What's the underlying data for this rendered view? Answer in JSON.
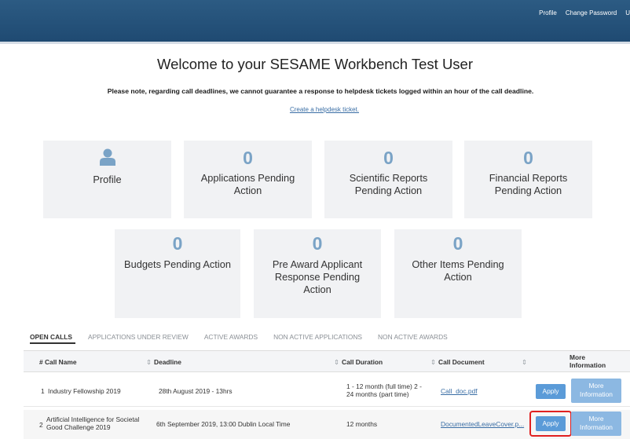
{
  "header": {
    "links": [
      "Profile",
      "Change Password",
      "U"
    ]
  },
  "welcome_title": "Welcome to your SESAME Workbench Test User",
  "notice": "Please note, regarding call deadlines, we cannot guarantee a response to helpdesk tickets logged within an hour of the call deadline.",
  "helpdesk_link": "Create a helpdesk ticket.",
  "tiles": {
    "profile": {
      "label": "Profile",
      "icon": "user-icon"
    },
    "applications_pending": {
      "count": "0",
      "label_lines": [
        "Applications Pending",
        "Action"
      ]
    },
    "scientific_reports": {
      "count": "0",
      "label_lines": [
        "Scientific Reports",
        "Pending Action"
      ]
    },
    "financial_reports": {
      "count": "0",
      "label_lines": [
        "Financial Reports",
        "Pending Action"
      ]
    },
    "budgets_pending": {
      "count": "0",
      "label_lines": [
        "Budgets Pending Action"
      ]
    },
    "pre_award": {
      "count": "0",
      "label_lines": [
        "Pre Award Applicant",
        "Response Pending",
        "Action"
      ]
    },
    "other_items": {
      "count": "0",
      "label_lines": [
        "Other Items Pending",
        "Action"
      ]
    }
  },
  "tabs": [
    "OPEN CALLS",
    "APPLICATIONS UNDER REVIEW",
    "ACTIVE AWARDS",
    "NON ACTIVE APPLICATIONS",
    "NON ACTIVE AWARDS"
  ],
  "table": {
    "headers": {
      "num_name": "# Call Name",
      "deadline": "Deadline",
      "duration": "Call Duration",
      "document": "Call Document",
      "more_info_lines": [
        "More",
        "Information"
      ]
    },
    "rows": [
      {
        "num": "1",
        "name_lines": [
          "Industry Fellowship 2019"
        ],
        "deadline": "28th August 2019 - 13hrs",
        "duration_lines": [
          "1 - 12 month (full time) 2 -",
          "24 months (part time)"
        ],
        "document": "Call_doc.pdf",
        "apply": "Apply",
        "more_lines": [
          "More",
          "Information"
        ]
      },
      {
        "num": "2",
        "name_lines": [
          "Artificial Intelligence for Societal",
          "Good Challenge 2019"
        ],
        "deadline": "6th September 2019, 13:00 Dublin Local Time",
        "duration_lines": [
          "12 months"
        ],
        "document": "DocumentedLeaveCover.p...",
        "apply": "Apply",
        "more_lines": [
          "More",
          "Information"
        ]
      }
    ]
  },
  "colors": {
    "header_bg": "#2c5b83",
    "tile_bg": "#f1f2f4",
    "count_color": "#7aa3c6",
    "apply_button": "#5b9bd8",
    "more_button": "#8cb8e2",
    "highlight": "#e02020"
  }
}
